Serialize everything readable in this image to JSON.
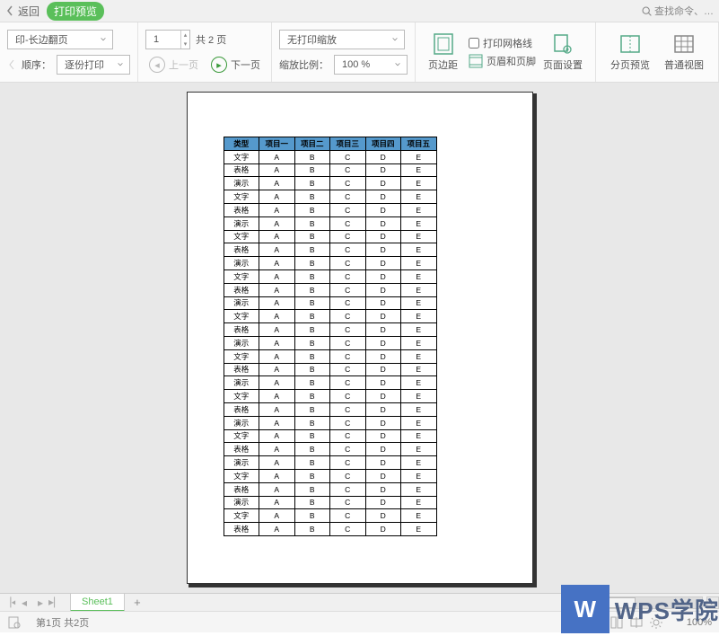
{
  "titlebar": {
    "back_label": "返回",
    "badge_label": "打印预览",
    "search_placeholder": "查找命令、…"
  },
  "ribbon": {
    "duplex": "印-长边翻页",
    "order_label": "顺序：",
    "order_value": "逐份打印",
    "page_input": "1",
    "page_total": "共 2 页",
    "prev_label": "上一页",
    "next_label": "下一页",
    "scale_mode": "无打印缩放",
    "zoom_label": "缩放比例：",
    "zoom_value": "100 %",
    "margins_label": "页边距",
    "gridlines_label": "打印网格线",
    "header_footer_label": "页眉和页脚",
    "page_setup_label": "页面设置",
    "pagebreak_label": "分页预览",
    "normal_view_label": "普通视图"
  },
  "chart_data": {
    "type": "table",
    "headers": [
      "类型",
      "项目一",
      "项目二",
      "项目三",
      "项目四",
      "项目五"
    ],
    "row_types": [
      "文字",
      "表格",
      "演示",
      "文字",
      "表格",
      "演示",
      "文字",
      "表格",
      "演示",
      "文字",
      "表格",
      "演示",
      "文字",
      "表格",
      "演示",
      "文字",
      "表格",
      "演示",
      "文字",
      "表格",
      "演示",
      "文字",
      "表格",
      "演示",
      "文字",
      "表格",
      "演示",
      "文字",
      "表格"
    ],
    "row_values": [
      "A",
      "B",
      "C",
      "D",
      "E"
    ]
  },
  "sheet_tabs": {
    "tab1": "Sheet1"
  },
  "status": {
    "page_info": "第1页 共2页",
    "zoom": "100%"
  },
  "watermark": {
    "logo_text": "W",
    "label": "WPS学院"
  }
}
